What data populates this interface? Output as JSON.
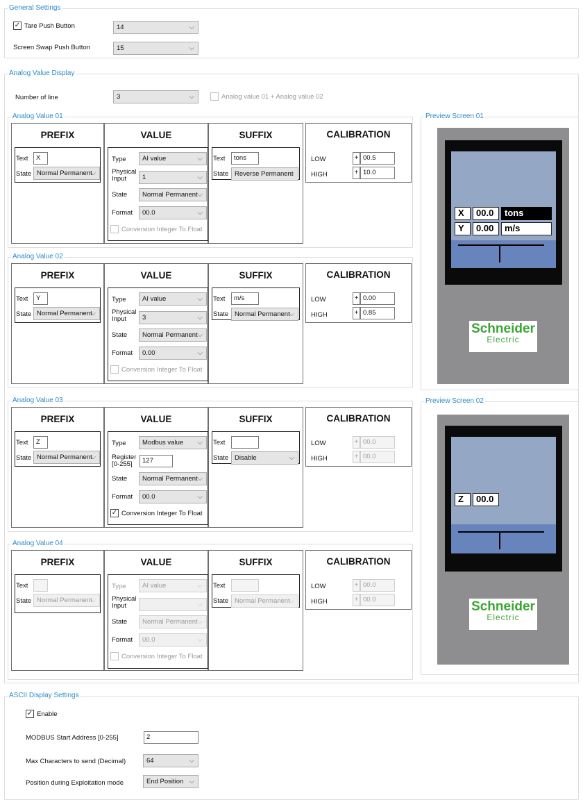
{
  "general": {
    "title": "General Settings",
    "tare_label": "Tare Push Button",
    "tare_value": "14",
    "swap_label": "Screen Swap Push Button",
    "swap_value": "15"
  },
  "analog_display": {
    "title": "Analog Value Display",
    "num_line_label": "Number of line",
    "num_line_value": "3",
    "combine_label": "Analog value 01 + Analog value 02"
  },
  "headers": {
    "prefix": "PREFIX",
    "value": "VALUE",
    "suffix": "SUFFIX",
    "calibration": "CALIBRATION"
  },
  "labels": {
    "text": "Text",
    "state": "State",
    "type": "Type",
    "physical_input": "Physical Input",
    "register": "Register [0-255]",
    "format": "Format",
    "conversion": "Conversion Integer To Float",
    "low": "LOW",
    "high": "HIGH",
    "plus": "+"
  },
  "av": [
    {
      "title": "Analog Value 01",
      "prefix_text": "X",
      "prefix_state": "Normal Permanent",
      "type": "AI value",
      "phys": "1",
      "state": "Normal Permanent",
      "format": "00.0",
      "conv_checked": false,
      "suffix_text": "tons",
      "suffix_state": "Reverse Permanent",
      "low": "00.5",
      "high": "10.0"
    },
    {
      "title": "Analog Value 02",
      "prefix_text": "Y",
      "prefix_state": "Normal Permanent",
      "type": "AI value",
      "phys": "3",
      "state": "Normal Permanent",
      "format": "0.00",
      "conv_checked": false,
      "suffix_text": "m/s",
      "suffix_state": "Normal Permanent",
      "low": "0.00",
      "high": "0.85"
    },
    {
      "title": "Analog Value 03",
      "prefix_text": "Z",
      "prefix_state": "Normal Permanent",
      "type": "Modbus value",
      "register": "127",
      "state": "Normal Permanent",
      "format": "00.0",
      "conv_checked": true,
      "suffix_text": "",
      "suffix_state": "Disable",
      "low": "00.0",
      "high": "00.0"
    },
    {
      "title": "Analog Value 04",
      "prefix_text": "",
      "prefix_state": "Normal Permanent",
      "type": "AI value",
      "phys": "",
      "state": "Normal Permanent",
      "format": "00.0",
      "conv_checked": false,
      "suffix_text": "",
      "suffix_state": "Normal Permanent",
      "low": "00.0",
      "high": "00.0"
    }
  ],
  "preview1": {
    "title": "Preview Screen 01",
    "row1": [
      "X",
      "00.0",
      "tons"
    ],
    "row2": [
      "Y",
      "0.00",
      "m/s"
    ]
  },
  "preview2": {
    "title": "Preview Screen 02",
    "row1": [
      "Z",
      "00.0"
    ]
  },
  "logo": {
    "line1": "Schneider",
    "line2": "Electric"
  },
  "ascii": {
    "title": "ASCII Display Settings",
    "enable_label": "Enable",
    "start_label": "MODBUS Start Address [0-255]",
    "start_value": "2",
    "max_label": "Max Characters to send (Decimal)",
    "max_value": "64",
    "pos_label": "Position during Exploitation mode",
    "pos_value": "End Position"
  },
  "colors": {
    "accent": "#2e8ac9",
    "lcd": "#94a8c6",
    "lcd_band": "#6884bc",
    "logo_green": "#3aa535"
  }
}
